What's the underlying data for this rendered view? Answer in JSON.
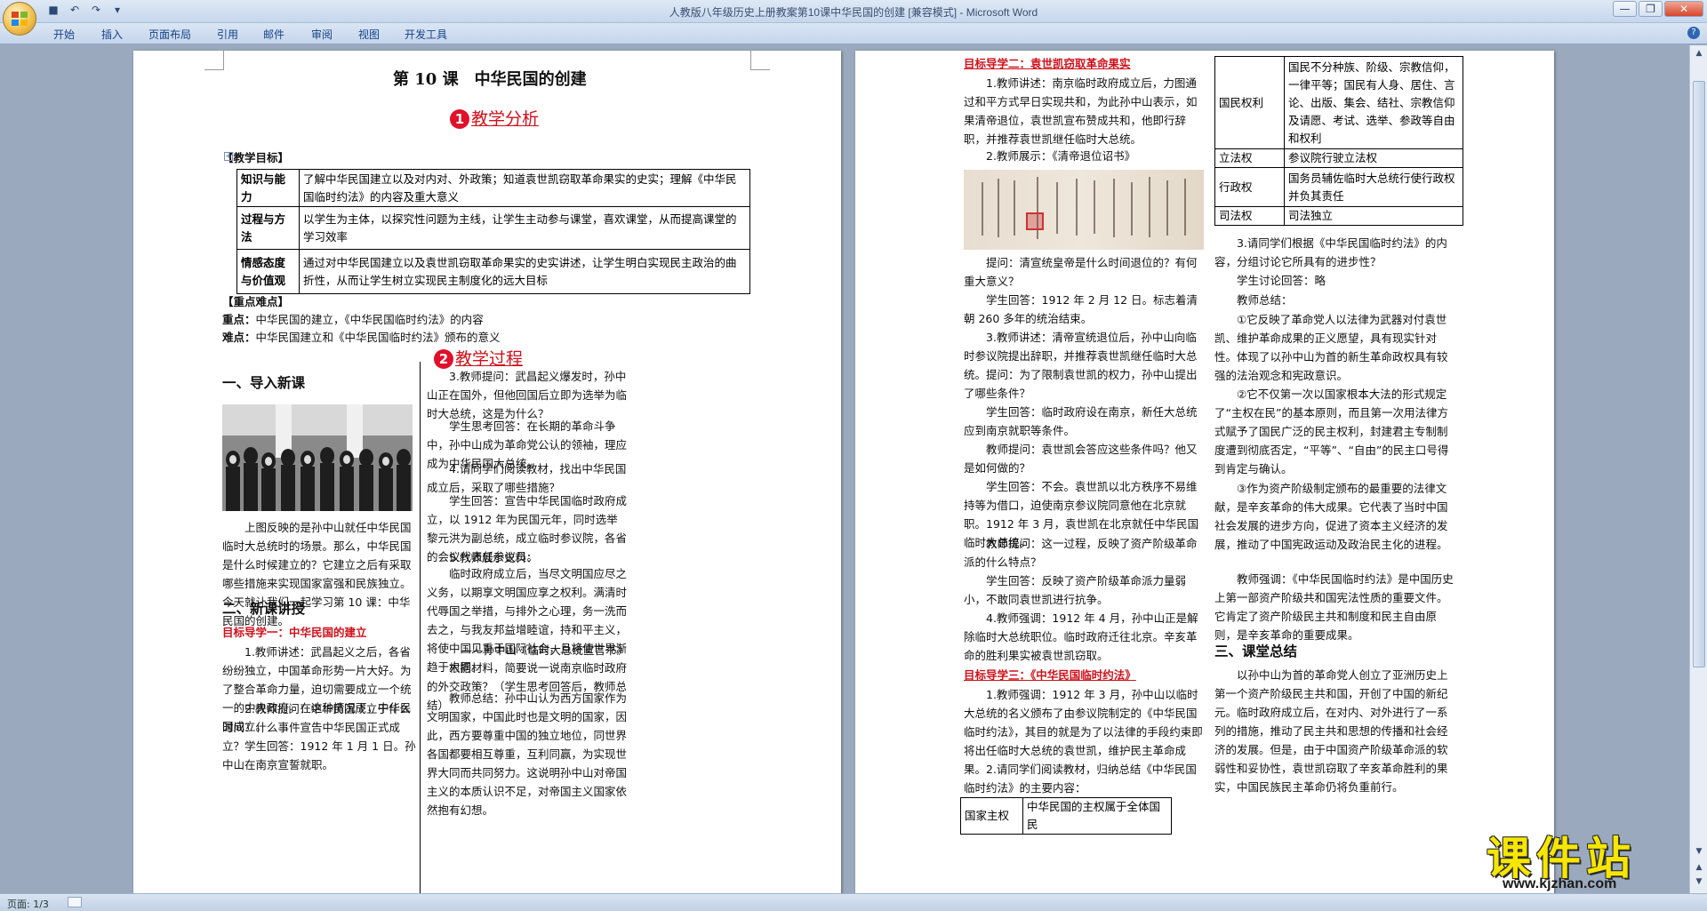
{
  "window": {
    "title": "人教版八年级历史上册教案第10课中华民国的创建 [兼容模式] - Microsoft Word",
    "qat_icons": [
      "save-icon",
      "undo-icon",
      "redo-icon",
      "customize-icon"
    ]
  },
  "ribbon": {
    "tabs": [
      "开始",
      "插入",
      "页面布局",
      "引用",
      "邮件",
      "审阅",
      "视图",
      "开发工具"
    ]
  },
  "status": {
    "page": "页面: 1/3"
  },
  "watermark": {
    "big": "课件站",
    "small": "www.kjzhan.com"
  },
  "page1": {
    "title": "第 10 课　中华民国的创建",
    "sec1": {
      "num": "1",
      "label": "教学分析"
    },
    "objectives_heading": "【教学目标】",
    "objectives": [
      {
        "k": "知识与能力",
        "v": "了解中华民国建立以及对内对、外政策；知道袁世凯窃取革命果实的史实；理解《中华民国临时约法》的内容及重大意义"
      },
      {
        "k": "过程与方法",
        "v": "以学生为主体，以探究性问题为主线，让学生主动参与课堂，喜欢课堂，从而提高课堂的学习效率"
      },
      {
        "k": "情感态度与价值观",
        "v": "通过对中华民国建立以及袁世凯窃取革命果实的史实讲述，让学生明白实现民主政治的曲折性，从而让学生树立实现民主制度化的远大目标"
      }
    ],
    "key_heading": "【重点难点】",
    "key_line": "中华民国的建立，《中华民国临时约法》的内容",
    "key_label": "重点：",
    "diff_label": "难点：",
    "diff_line": "中华民国建立和《中华民国临时约法》颁布的意义",
    "sec2": {
      "num": "2",
      "label": "教学过程"
    },
    "h_intro": "一、导入新课",
    "intro_text": "上图反映的是孙中山就任中华民国临时大总统时的场景。那么，中华民国是什么时候建立的？它建立之后有采取哪些措施来实现国家富强和民族独立。今天就让我们一起学习第 10 课：中华民国的创建。",
    "h_new": "二、新课讲授",
    "goal1": "目标导学一：中华民国的建立",
    "left_paras": [
      "1.教师讲述：武昌起义之后，各省纷纷独立，中国革命形势一片大好。为了整合革命力量，迫切需要成立一个统一的中央政府。在这种情况下，中华民国成立。",
      "2.教师提问：中华民国成立于什么时间？什么事件宣告中华民国正式成立？",
      "学生回答：1912 年 1 月 1 日。孙中山在南京宣誓就职。"
    ],
    "right_paras": [
      "3.教师提问：武昌起义爆发时，孙中山正在国外，但他回国后立即为选举为临时大总统，这是为什么？",
      "学生思考回答：在长期的革命斗争中，孙中山成为革命党公认的领袖，理应成为中华民国大总统。",
      "4.请同学们阅读教材，找出中华民国成立后，采取了哪些措施？",
      "学生回答：宣告中华民国临时政府成立，以 1912 年为民国元年，同时选举黎元洪为副总统，成立临时参议院，各省的会议代表任参议员。",
      "5.教师展示史料：",
      "临时政府成立后，当尽文明国应尽之义务，以期享文明国应享之权利。满清时代辱国之举措，与排外之心理，务一洗而去之，与我友邦益增睦谊，持和平主义，将使中国见重于国际社会，且将使世界渐趋于大同。",
      "——孙中山《临时大总统宣言书》",
      "根据材料，简要说一说南京临时政府的外交政策？（学生思考回答后，教师总结）",
      "教师总结：孙中山认为西方国家作为文明国家，中国此时也是文明的国家，因此，西方要尊重中国的独立地位，同世界各国都要相互尊重，互利同赢，为实现世界大同而共同努力。这说明孙中山对帝国主义的本质认识不足，对帝国主义国家依然抱有幻想。"
    ]
  },
  "page2": {
    "goal2": "目标导学二：袁世凯窃取革命果实",
    "paras_a": [
      "1.教师讲述：南京临时政府成立后，力图通过和平方式早日实现共和，为此孙中山表示，如果清帝退位，袁世凯宣布赞成共和，他即行辞职，并推荐袁世凯继任临时大总统。",
      "2.教师展示：《清帝退位诏书》"
    ],
    "paras_b": [
      "提问：清宣统皇帝是什么时间退位的？有何重大意义？",
      "学生回答：1912 年 2 月 12 日。标志着清朝 260 多年的统治结束。",
      "3.教师讲述：清帝宣统退位后，孙中山向临时参议院提出辞职，并推荐袁世凯继任临时大总统。提问：为了限制袁世凯的权力，孙中山提出了哪些条件？",
      "学生回答：临时政府设在南京，新任大总统应到南京就职等条件。",
      "教师提问：袁世凯会答应这些条件吗？他又是如何做的？",
      "学生回答：不会。袁世凯以北方秩序不易维持等为借口，迫使南京参议院同意他在北京就职。1912 年 3 月，袁世凯在北京就任中华民国临时大总统。",
      "教师提问：这一过程，反映了资产阶级革命派的什么特点？",
      "学生回答：反映了资产阶级革命派力量弱小，不敢同袁世凯进行抗争。",
      "4.教师强调：1912 年 4 月，孙中山正是解除临时大总统职位。临时政府迁往北京。辛亥革命的胜利果实被袁世凯窃取。"
    ],
    "goal3": "目标导学三：《中华民国临时约法》",
    "paras_c": [
      "1.教师强调：1912 年 3 月，孙中山以临时大总统的名义颁布了由参议院制定的《中华民国临时约法》，其目的就是为了以法律的手段约束即将出任临时大总统的袁世凯，维护民主革命成果。",
      "2.请同学们阅读教材，归纳总结《中华民国临时约法》的主要内容："
    ],
    "table_bottom": {
      "k": "国家主权",
      "v": "中华民国的主权属于全体国民"
    },
    "table_right": [
      {
        "k": "国民权利",
        "v": "国民不分种族、阶级、宗教信仰，一律平等；国民有人身、居住、言论、出版、集会、结社、宗教信仰及请愿、考试、选举、参政等自由和权利"
      },
      {
        "k": "立法权",
        "v": "参议院行驶立法权"
      },
      {
        "k": "行政权",
        "v": "国务员辅佐临时大总统行使行政权并负其责任"
      },
      {
        "k": "司法权",
        "v": "司法独立"
      }
    ],
    "paras_d": [
      "3.请同学们根据《中华民国临时约法》的内容，分组讨论它所具有的进步性？",
      "学生讨论回答：略",
      "教师总结：",
      "①它反映了革命党人以法律为武器对付袁世凯、维护革命成果的正义愿望，具有现实针对性。体现了以孙中山为首的新生革命政权具有较强的法治观念和宪政意识。",
      "②它不仅第一次以国家根本大法的形式规定了“主权在民”的基本原则，而且第一次用法律方式赋予了国民广泛的民主权利，封建君主专制制度遭到彻底否定，“平等”、“自由”的民主口号得到肯定与确认。",
      "③作为资产阶级制定颁布的最重要的法律文献，是辛亥革命的伟大成果。它代表了当时中国社会发展的进步方向，促进了资本主义经济的发展，推动了中国宪政运动及政治民主化的进程。",
      "教师强调：《中华民国临时约法》是中国历史上第一部资产阶级共和国宪法性质的重要文件。它肯定了资产阶级民主共和制度和民主自由原则，是辛亥革命的重要成果。"
    ],
    "h_summary": "三、课堂总结",
    "summary": "以孙中山为首的革命党人创立了亚洲历史上第一个资产阶级民主共和国，开创了中国的新纪元。临时政府成立后，在对内、对外进行了一系列的措施，推动了民主共和思想的传播和社会经济的发展。但是，由于中国资产阶级革命派的软弱性和妥协性，袁世凯窃取了辛亥革命胜利的果实，中国民族民主革命仍将负重前行。"
  }
}
